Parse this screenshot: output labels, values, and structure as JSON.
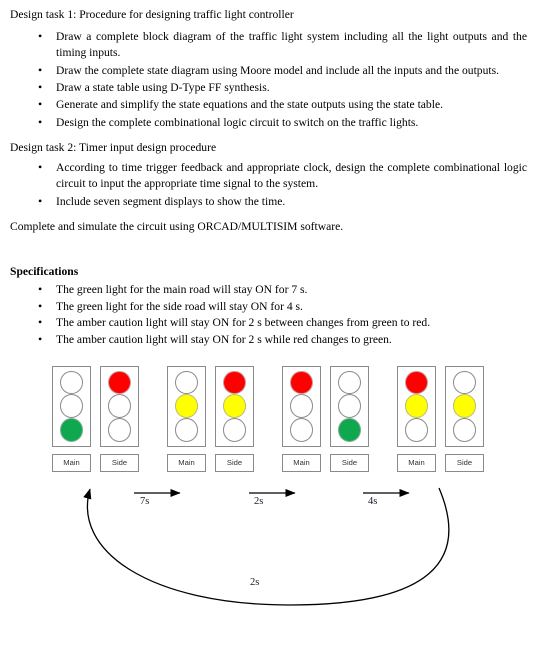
{
  "document": {
    "task1": {
      "heading": "Design task 1: Procedure for designing traffic light controller",
      "bullets": [
        "Draw a complete block diagram of the traffic light system including all the light outputs and the timing inputs.",
        "Draw the complete state diagram using Moore model and include all the inputs and the outputs.",
        "Draw a state table using D-Type FF synthesis.",
        "Generate and simplify the state equations and the state outputs using the state table.",
        "Design the complete combinational logic circuit to switch on the traffic lights."
      ]
    },
    "task2": {
      "heading": "Design task 2: Timer input design procedure",
      "bullets": [
        "According to time trigger feedback and appropriate clock, design the complete combinational logic circuit to input the appropriate time signal to the system.",
        "Include seven segment displays to show the time."
      ]
    },
    "closing_note": "Complete and simulate the circuit using ORCAD/MULTISIM software.",
    "specifications": {
      "heading": "Specifications",
      "bullets": [
        "The green light for the main road will stay ON for 7 s.",
        "The green light for the side road will stay ON for 4 s.",
        "The amber caution light will stay ON for 2 s between changes from green to red.",
        "The amber caution light will stay ON for 2 s while red changes to green."
      ]
    }
  },
  "diagram": {
    "colors": {
      "red": "#ff0000",
      "amber": "#ffff00",
      "green": "#0fa84f",
      "off": "#ffffff",
      "outline": "#8a8a8a"
    },
    "labels": {
      "main": "Main",
      "side": "Side"
    },
    "states": [
      {
        "index": 1,
        "main": {
          "red": false,
          "amber": false,
          "green": true
        },
        "side": {
          "red": true,
          "amber": false,
          "green": false
        }
      },
      {
        "index": 2,
        "main": {
          "red": false,
          "amber": true,
          "green": false
        },
        "side": {
          "red": true,
          "amber": true,
          "green": false
        }
      },
      {
        "index": 3,
        "main": {
          "red": true,
          "amber": false,
          "green": false
        },
        "side": {
          "red": false,
          "amber": false,
          "green": true
        }
      },
      {
        "index": 4,
        "main": {
          "red": true,
          "amber": true,
          "green": false
        },
        "side": {
          "red": false,
          "amber": true,
          "green": false
        }
      }
    ],
    "transitions": [
      {
        "from": 1,
        "to": 2,
        "label": "7s"
      },
      {
        "from": 2,
        "to": 3,
        "label": "2s"
      },
      {
        "from": 3,
        "to": 4,
        "label": "4s"
      },
      {
        "from": 4,
        "to": 1,
        "label": "2s"
      }
    ]
  }
}
